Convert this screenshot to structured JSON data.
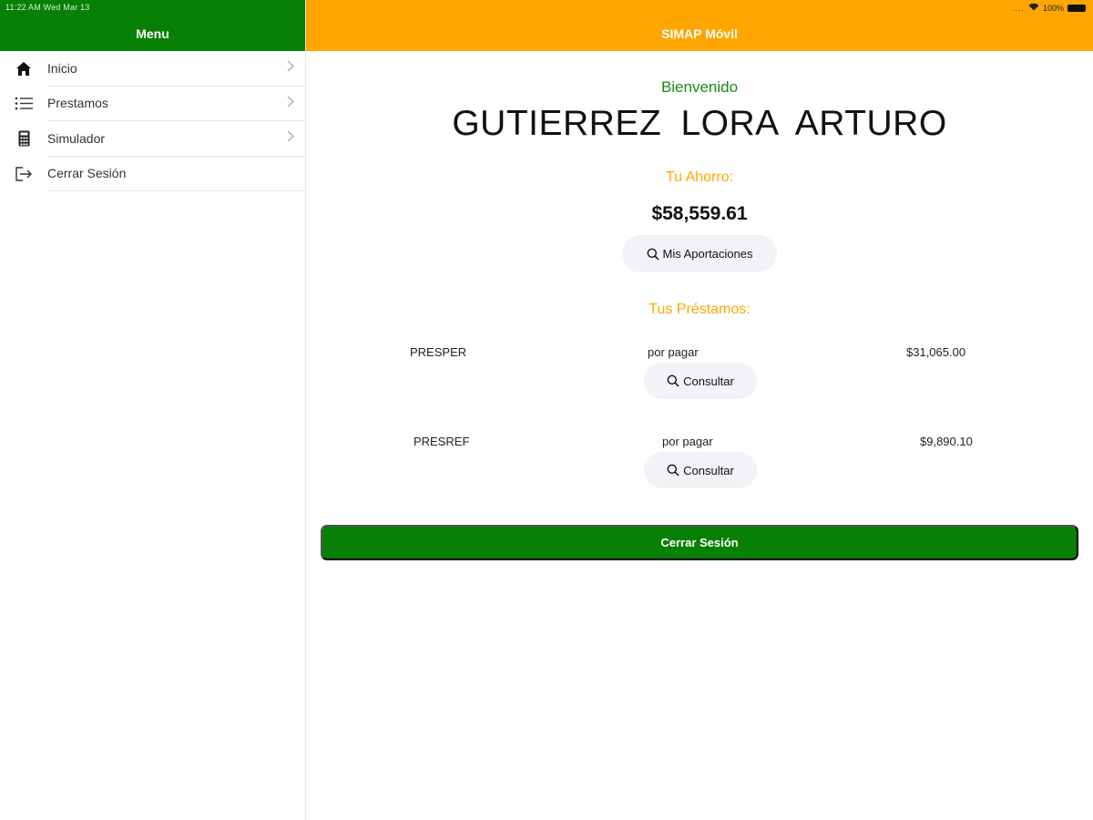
{
  "status_bar": {
    "time_date": "11:22 AM   Wed Mar 13",
    "signal": "....",
    "battery": "100%"
  },
  "sidebar": {
    "title": "Menu",
    "items": [
      {
        "label": "Inicio",
        "icon": "home-icon",
        "chevron": true
      },
      {
        "label": "Prestamos",
        "icon": "list-icon",
        "chevron": true
      },
      {
        "label": "Simulador",
        "icon": "calculator-icon",
        "chevron": true
      },
      {
        "label": "Cerrar Sesión",
        "icon": "logout-icon",
        "chevron": false
      }
    ]
  },
  "header": {
    "title": "SIMAP Móvil"
  },
  "main": {
    "welcome": "Bienvenido",
    "user_name": "GUTIERREZ  LORA  ARTURO",
    "savings_label": "Tu Ahorro:",
    "savings_value": "$58,559.61",
    "contributions_button": "Mis Aportaciones",
    "loans_label": "Tus Préstamos:",
    "loans": [
      {
        "name": "PRESPER",
        "status": "por pagar",
        "amount": "$31,065.00",
        "button": "Consultar"
      },
      {
        "name": "PRESREF",
        "status": "por pagar",
        "amount": "$9,890.10",
        "button": "Consultar"
      }
    ],
    "logout_button": "Cerrar Sesión"
  },
  "colors": {
    "green": "#088005",
    "orange": "#FFA601",
    "pill_bg": "#f1f3f6"
  }
}
